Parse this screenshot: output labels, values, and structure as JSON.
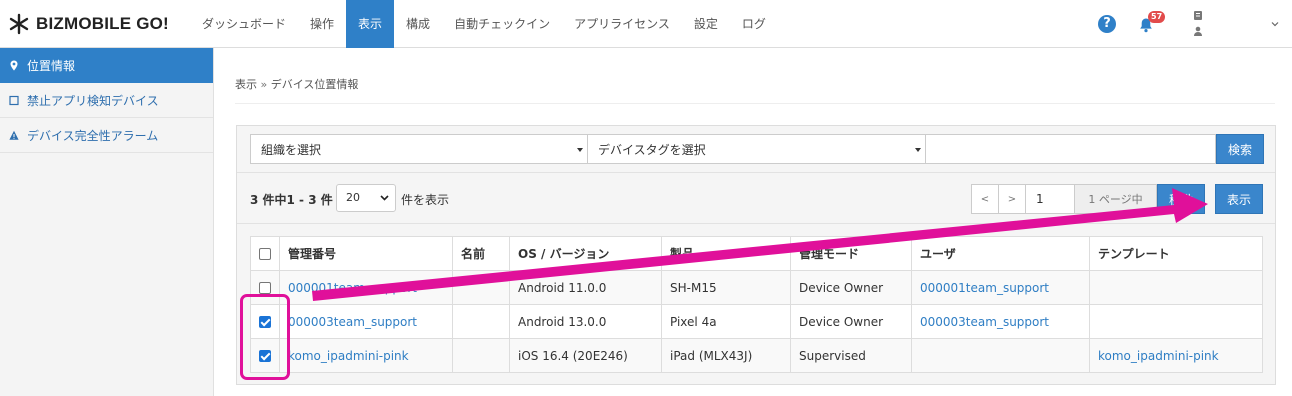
{
  "header": {
    "brand": "BIZMOBILE GO!",
    "nav": [
      "ダッシュボード",
      "操作",
      "表示",
      "構成",
      "自動チェックイン",
      "アプリライセンス",
      "設定",
      "ログ"
    ],
    "active_nav": "表示",
    "help_glyph": "?",
    "notification_count": "57"
  },
  "sidebar": {
    "items": [
      {
        "label": "位置情報",
        "icon": "map-marker-icon"
      },
      {
        "label": "禁止アプリ検知デバイス",
        "icon": "square-icon"
      },
      {
        "label": "デバイス完全性アラーム",
        "icon": "warning-icon"
      }
    ]
  },
  "breadcrumb": {
    "parent": "表示",
    "separator": "»",
    "current": "デバイス位置情報"
  },
  "filters": {
    "org_select": "組織を選択",
    "tag_select": "デバイスタグを選択",
    "search_value": "",
    "search_button": "検索"
  },
  "pagination": {
    "summary": "3 件中1 - 3 件",
    "per_page": "20",
    "per_page_label": "件を表示",
    "prev": "<",
    "next": ">",
    "page": "1",
    "page_label": "1 ページ中",
    "go_button": "移動",
    "show_button": "表示"
  },
  "table": {
    "headers": [
      "管理番号",
      "名前",
      "OS / バージョン",
      "製品",
      "管理モード",
      "ユーザ",
      "テンプレート"
    ],
    "rows": [
      {
        "checked": false,
        "id": "000001team_support",
        "name": "",
        "os": "Android 11.0.0",
        "product": "SH-M15",
        "mode": "Device Owner",
        "user": "000001team_support",
        "template": ""
      },
      {
        "checked": true,
        "id": "000003team_support",
        "name": "",
        "os": "Android 13.0.0",
        "product": "Pixel 4a",
        "mode": "Device Owner",
        "user": "000003team_support",
        "template": ""
      },
      {
        "checked": true,
        "id": "komo_ipadmini-pink",
        "name": "",
        "os": "iOS 16.4 (20E246)",
        "product": "iPad (MLX43J)",
        "mode": "Supervised",
        "user": "",
        "template": "komo_ipadmini-pink"
      }
    ]
  },
  "colors": {
    "primary": "#2f80c8",
    "link": "#2f7ec4",
    "annotation": "#e0109a",
    "badge": "#e24b4b"
  }
}
